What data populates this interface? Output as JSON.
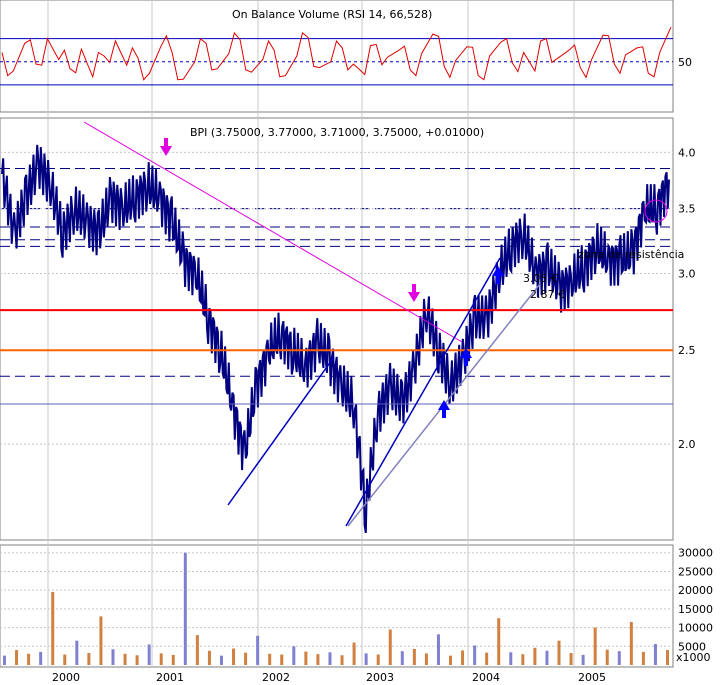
{
  "rsi_title": "On Balance Volume (RSI 14, 66,528)",
  "main_title": "BPI (3.75000, 3.77000, 3.71000, 3.75000, +0.01000)",
  "annotation_zone": "zona de resistência",
  "annotation_price1": "3.05 €",
  "annotation_price2": "2.87 €",
  "volume_unit": "x1000",
  "colors": {
    "background": "#ffffff",
    "grid": "#c8c8c8",
    "price_bars": "#000080",
    "rsi_line": "#e00000",
    "rsi_band": "#0000c0",
    "trend_lines": "#0000c0",
    "resistance_red": "#ff0000",
    "resistance_orange": "#ff6000",
    "support_blue": "#6060c0",
    "downtrend_line": "#e000e0",
    "arrow_magenta": "#e000e0",
    "arrow_blue": "#0000ff",
    "volume_orange": "#d08040",
    "volume_blue": "#8080d0"
  },
  "chart_data": [
    {
      "type": "line",
      "panel": "rsi",
      "y_ticks": [
        50
      ],
      "bands": [
        30,
        70
      ],
      "series": [
        {
          "values": [
            58,
            42,
            66,
            48,
            70,
            52,
            44,
            61,
            37,
            55,
            68,
            47,
            53,
            40,
            63,
            58,
            35,
            50,
            66,
            44,
            57,
            69,
            41,
            52,
            60,
            38,
            55,
            71,
            45,
            50,
            62,
            48,
            39,
            65,
            54,
            60,
            43,
            57,
            74,
            46,
            51,
            63,
            38,
            55,
            67,
            49,
            58,
            42,
            70,
            53,
            60,
            45,
            52,
            73,
            48,
            56,
            62,
            40,
            58,
            80
          ]
        }
      ]
    },
    {
      "type": "line",
      "panel": "price",
      "x_ticks": [
        "2000",
        "2001",
        "2002",
        "2003",
        "2004",
        "2005"
      ],
      "y_ticks": [
        2.0,
        2.5,
        3.0,
        3.5,
        4.0
      ],
      "ylim": [
        1.6,
        4.3
      ],
      "y_scale": "log",
      "series": [
        {
          "name": "BPI",
          "values": [
            3.8,
            3.3,
            3.6,
            3.9,
            3.7,
            3.3,
            3.5,
            3.4,
            3.3,
            3.6,
            3.5,
            3.6,
            3.7,
            3.6,
            3.4,
            3.1,
            3.0,
            2.7,
            2.5,
            2.2,
            1.95,
            2.3,
            2.5,
            2.6,
            2.5,
            2.4,
            2.55,
            2.45,
            2.3,
            2.2,
            1.7,
            2.15,
            2.3,
            2.2,
            2.4,
            2.75,
            2.5,
            2.3,
            2.45,
            2.7,
            2.7,
            3.0,
            3.2,
            3.3,
            3.0,
            3.05,
            2.9,
            2.95,
            3.05,
            3.2,
            3.1,
            3.1,
            3.15,
            3.5,
            3.5,
            3.75
          ]
        }
      ],
      "horizontal_lines": {
        "red": 2.75,
        "orange": 2.5,
        "blue": 2.2
      },
      "dashed_lines": [
        3.85,
        3.5,
        3.35,
        3.25,
        3.2,
        2.35
      ]
    },
    {
      "type": "bar",
      "panel": "volume",
      "y_ticks": [
        5000,
        10000,
        15000,
        20000,
        25000,
        30000
      ],
      "ylim": [
        0,
        31000
      ],
      "values": [
        2500,
        4000,
        3000,
        3500,
        19500,
        2800,
        6500,
        3200,
        13000,
        4200,
        3000,
        2600,
        5500,
        3100,
        2700,
        30000,
        8000,
        3800,
        2500,
        4400,
        3300,
        7800,
        3000,
        2800,
        5000,
        3600,
        2900,
        3400,
        2600,
        6000,
        3100,
        2800,
        9500,
        3700,
        4300,
        3100,
        8200,
        2500,
        3900,
        5200,
        3300,
        12500,
        3400,
        2900,
        4600,
        3800,
        6500,
        3200,
        2700,
        10000,
        4100,
        3700,
        11500,
        3500,
        5600,
        4000
      ]
    }
  ]
}
